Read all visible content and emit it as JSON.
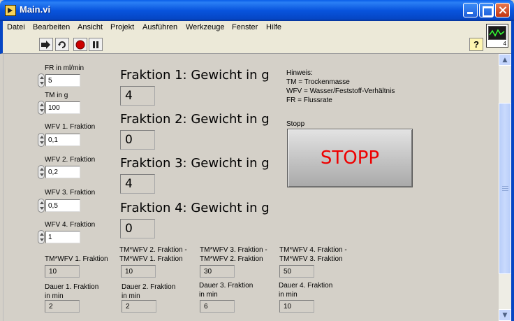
{
  "window": {
    "title": "Main.vi"
  },
  "menu": [
    "Datei",
    "Bearbeiten",
    "Ansicht",
    "Projekt",
    "Ausführen",
    "Werkzeuge",
    "Fenster",
    "Hilfe"
  ],
  "toolbar": {
    "help_glyph": "?",
    "vi_icon_number": "4"
  },
  "controls": {
    "fr": {
      "label": "FR in ml/min",
      "value": "5"
    },
    "tm": {
      "label": "TM in g",
      "value": "100"
    },
    "wfv1": {
      "label": "WFV 1. Fraktion",
      "value": "0,1"
    },
    "wfv2": {
      "label": "WFV 2. Fraktion",
      "value": "0,2"
    },
    "wfv3": {
      "label": "WFV 3. Fraktion",
      "value": "0,5"
    },
    "wfv4": {
      "label": "WFV 4. Fraktion",
      "value": "1"
    }
  },
  "fractions": [
    {
      "label": "Fraktion 1: Gewicht in g",
      "value": "4"
    },
    {
      "label": "Fraktion 2: Gewicht in g",
      "value": "0"
    },
    {
      "label": "Fraktion 3: Gewicht in g",
      "value": "4"
    },
    {
      "label": "Fraktion 4: Gewicht in g",
      "value": "0"
    }
  ],
  "hint": {
    "title": "Hinweis:",
    "line1": "TM = Trockenmasse",
    "line2": "WFV = Wasser/Feststoff-Verhältnis",
    "line3": "FR = Flussrate"
  },
  "stop": {
    "label": "Stopp",
    "button": "STOPP"
  },
  "tmwfv": [
    {
      "label1": "TM*WFV 1. Fraktion",
      "label2": "",
      "value": "10"
    },
    {
      "label1": "TM*WFV 2. Fraktion -",
      "label2": "TM*WFV 1. Fraktion",
      "value": "10"
    },
    {
      "label1": "TM*WFV 3. Fraktion -",
      "label2": "TM*WFV 2. Fraktion",
      "value": "30"
    },
    {
      "label1": "TM*WFV 4. Fraktion -",
      "label2": "TM*WFV 3. Fraktion",
      "value": "50"
    }
  ],
  "dauer": [
    {
      "label1": "Dauer 1. Fraktion",
      "label2": "in min",
      "value": "2"
    },
    {
      "label1": "Dauer 2. Fraktion",
      "label2": "in min",
      "value": "2"
    },
    {
      "label1": "Dauer 3. Fraktion",
      "label2": "in min",
      "value": "6"
    },
    {
      "label1": "Dauer 4. Fraktion",
      "label2": "in min",
      "value": "10"
    }
  ],
  "colors": {
    "titlebar": "#0854dd",
    "panel": "#d4d0c8",
    "stop_text": "#ee0000"
  }
}
